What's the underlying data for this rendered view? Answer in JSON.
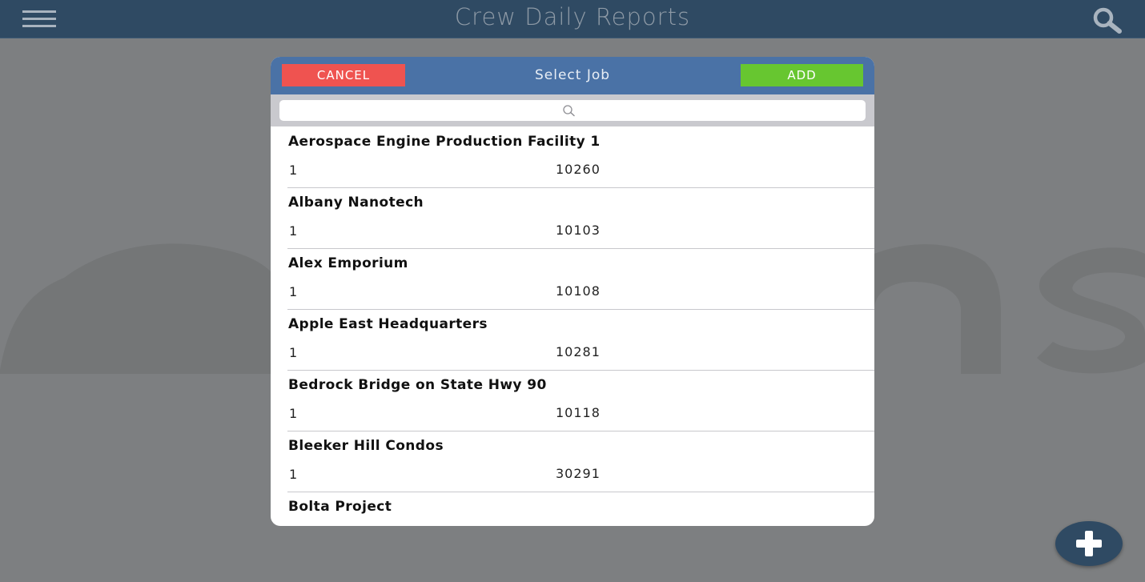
{
  "app": {
    "title": "Crew Daily Reports"
  },
  "navbar": {
    "menu_icon": "hamburger-icon",
    "search_icon": "search-icon",
    "bar_color": "#2f4a63"
  },
  "modal": {
    "title": "Select Job",
    "cancel_label": "CANCEL",
    "add_label": "ADD",
    "cancel_color": "#ef5350",
    "add_color": "#67c630",
    "header_color": "#4a72a6",
    "search": {
      "placeholder": "",
      "value": "",
      "icon": "magnifier-icon"
    },
    "jobs": [
      {
        "name": "Aerospace Engine Production Facility 1",
        "phase": "1",
        "number": "10260"
      },
      {
        "name": "Albany Nanotech",
        "phase": "1",
        "number": "10103"
      },
      {
        "name": "Alex Emporium",
        "phase": "1",
        "number": "10108"
      },
      {
        "name": "Apple East Headquarters",
        "phase": "1",
        "number": "10281"
      },
      {
        "name": "Bedrock Bridge on State Hwy 90",
        "phase": "1",
        "number": "10118"
      },
      {
        "name": "Bleeker Hill Condos",
        "phase": "1",
        "number": "30291"
      },
      {
        "name": "Bolta Project",
        "phase": "",
        "number": ""
      }
    ]
  },
  "fab": {
    "icon": "plus-icon"
  }
}
